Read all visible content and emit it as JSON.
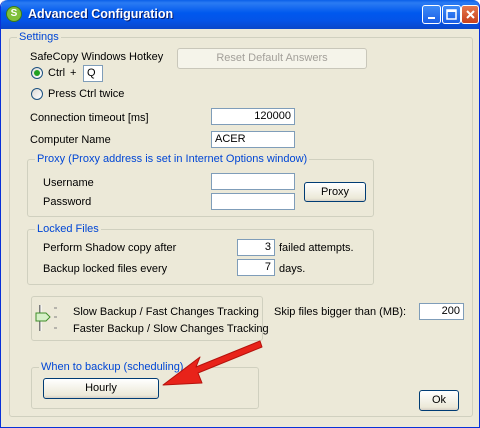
{
  "window": {
    "title": "Advanced Configuration"
  },
  "settings": {
    "legend": "Settings",
    "hotkey_label": "SafeCopy Windows Hotkey",
    "reset_button": "Reset Default Answers",
    "ctrl_option_label": "Ctrl",
    "plus": "+",
    "hotkey_key": "Q",
    "ctrl_twice_label": "Press Ctrl twice",
    "hotkey_selected": "Ctrl",
    "timeout_label": "Connection timeout [ms]",
    "timeout_value": "120000",
    "computer_label": "Computer Name",
    "computer_value": "ACER"
  },
  "proxy": {
    "legend": "Proxy (Proxy address is set in Internet Options window)",
    "username_label": "Username",
    "username_value": "",
    "password_label": "Password",
    "password_value": "",
    "proxy_button": "Proxy"
  },
  "locked": {
    "legend": "Locked Files",
    "shadow_label": "Perform Shadow copy after",
    "shadow_value": "3",
    "shadow_suffix": "failed attempts.",
    "backup_label": "Backup locked files every",
    "backup_value": "7",
    "backup_suffix": "days."
  },
  "tracking": {
    "slow_label": "Slow Backup / Fast Changes Tracking",
    "fast_label": "Faster Backup / Slow Changes Tracking",
    "skip_label": "Skip files bigger than (MB):",
    "skip_value": "200"
  },
  "schedule": {
    "legend": "When to backup (scheduling)",
    "hourly_button": "Hourly"
  },
  "ok_button": "Ok",
  "colors": {
    "titlebar": "#0058ee",
    "legend": "#0046d5",
    "arrow": "#e8231a"
  }
}
